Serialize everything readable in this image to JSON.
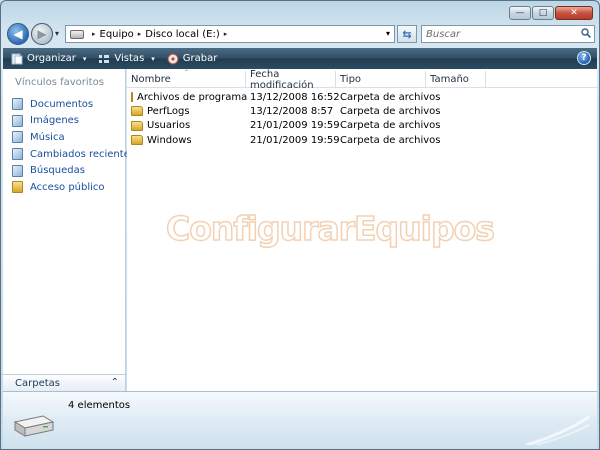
{
  "window": {
    "caption_buttons": {
      "minimize": "—",
      "maximize": "□",
      "close": "✕"
    }
  },
  "navigation": {
    "back_glyph": "◀",
    "forward_glyph": "▶",
    "history_caret": "▾",
    "breadcrumbs": [
      "Equipo",
      "Disco local (E:)"
    ],
    "crumb_separator": "▸",
    "address_caret": "▾",
    "refresh_glyph": "⇆"
  },
  "search": {
    "placeholder": "Buscar"
  },
  "toolbar": {
    "organize_label": "Organizar",
    "views_label": "Vistas",
    "burn_label": "Grabar",
    "caret": "▾",
    "help_label": "?"
  },
  "sidebar": {
    "header": "Vínculos favoritos",
    "items": [
      {
        "label": "Documentos",
        "icon": "documents-icon"
      },
      {
        "label": "Imágenes",
        "icon": "pictures-icon"
      },
      {
        "label": "Música",
        "icon": "music-icon"
      },
      {
        "label": "Cambiados reciente...",
        "icon": "recent-icon"
      },
      {
        "label": "Búsquedas",
        "icon": "searches-icon"
      },
      {
        "label": "Acceso público",
        "icon": "public-folder-icon"
      }
    ],
    "folders_label": "Carpetas",
    "folders_chevron": "⌃"
  },
  "filelist": {
    "sort_arrow": "⌃",
    "columns": {
      "name": "Nombre",
      "date": "Fecha modificación",
      "type": "Tipo",
      "size": "Tamaño"
    },
    "rows": [
      {
        "name": "Archivos de programa",
        "date": "13/12/2008 16:52",
        "type": "Carpeta de archivos"
      },
      {
        "name": "PerfLogs",
        "date": "13/12/2008 8:57",
        "type": "Carpeta de archivos"
      },
      {
        "name": "Usuarios",
        "date": "21/01/2009 19:59",
        "type": "Carpeta de archivos"
      },
      {
        "name": "Windows",
        "date": "21/01/2009 19:59",
        "type": "Carpeta de archivos"
      }
    ]
  },
  "watermark": "ConfigurarEquipos",
  "details": {
    "item_count": "4 elementos"
  },
  "colors": {
    "link": "#1a4fa0",
    "toolbar": "#2f4d63",
    "folder": "#d8a52a"
  }
}
